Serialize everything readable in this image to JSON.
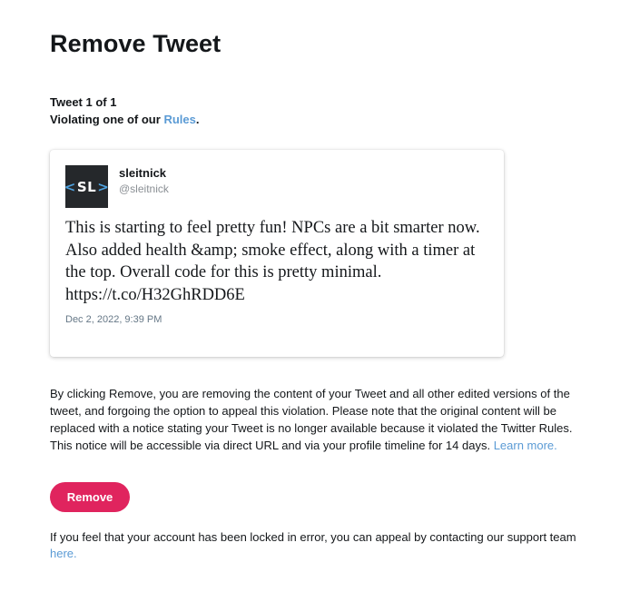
{
  "page": {
    "title": "Remove Tweet"
  },
  "counter": {
    "line1": "Tweet 1 of 1",
    "violation_prefix": "Violating one of our ",
    "rules_link": "Rules",
    "violation_suffix": "."
  },
  "tweet": {
    "avatar_text": "SL",
    "author_name": "sleitnick",
    "author_handle": "@sleitnick",
    "text": "This is starting to feel pretty fun! NPCs are a bit smarter now. Also added health &amp; smoke effect, along with a timer at the top. Overall code for this is pretty minimal. https://t.co/H32GhRDD6E",
    "timestamp": "Dec 2, 2022, 9:39 PM"
  },
  "disclaimer": {
    "text": "By clicking Remove, you are removing the content of your Tweet and all other edited versions of the tweet, and forgoing the option to appeal this violation. Please note that the original content will be replaced with a notice stating your Tweet is no longer available because it violated the Twitter Rules. This notice will be accessible via direct URL and via your profile timeline for 14 days. ",
    "learn_more": "Learn more."
  },
  "actions": {
    "remove_label": "Remove"
  },
  "appeal": {
    "text": "If you feel that your account has been locked in error, you can appeal by contacting our support team ",
    "link": "here."
  },
  "colors": {
    "remove_button": "#e0245e",
    "link": "#5b9bd5",
    "avatar_bg": "#25282b",
    "avatar_bracket": "#4fa3e0"
  }
}
